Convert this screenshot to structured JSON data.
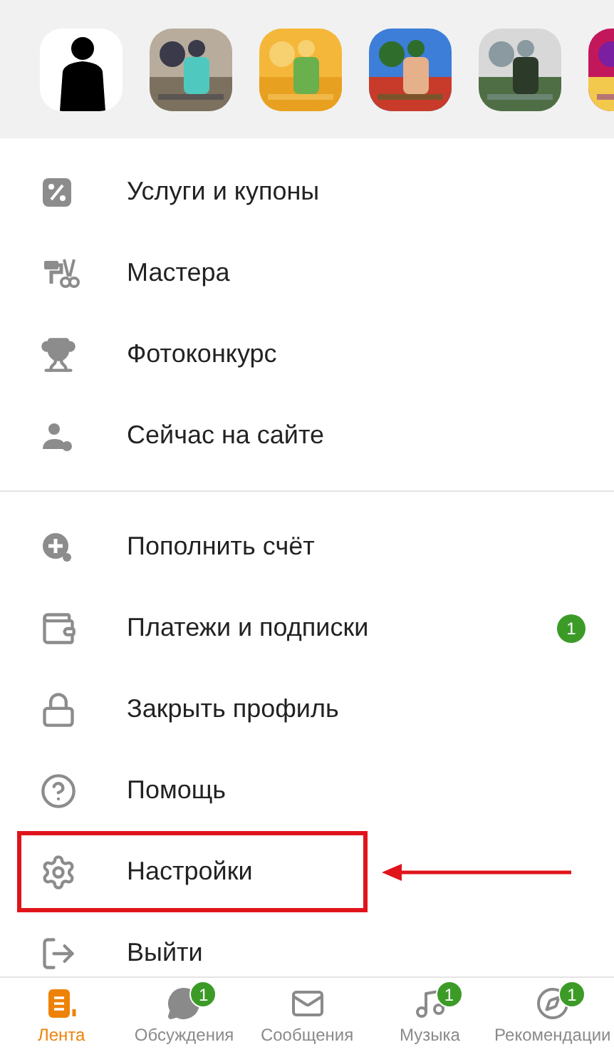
{
  "stories": [
    {
      "kind": "silhouette"
    },
    {
      "kind": "picture"
    },
    {
      "kind": "picture"
    },
    {
      "kind": "picture"
    },
    {
      "kind": "picture"
    },
    {
      "kind": "picture"
    }
  ],
  "menu_sections": [
    {
      "items": [
        {
          "label": "Услуги и купоны"
        },
        {
          "label": "Мастера"
        },
        {
          "label": "Фотоконкурс"
        },
        {
          "label": "Сейчас на сайте"
        }
      ]
    },
    {
      "items": [
        {
          "label": "Пополнить счёт"
        },
        {
          "label": "Платежи и подписки",
          "badge": "1"
        },
        {
          "label": "Закрыть профиль"
        },
        {
          "label": "Помощь"
        },
        {
          "label": "Настройки",
          "highlighted": true
        },
        {
          "label": "Выйти"
        }
      ]
    }
  ],
  "bottom_nav": [
    {
      "label": "Лента",
      "selected": true
    },
    {
      "label": "Обсуждения",
      "selected": false,
      "badge": "1"
    },
    {
      "label": "Сообщения",
      "selected": false
    },
    {
      "label": "Музыка",
      "selected": false,
      "badge": "1"
    },
    {
      "label": "Рекомендации",
      "selected": false,
      "badge": "1"
    }
  ]
}
